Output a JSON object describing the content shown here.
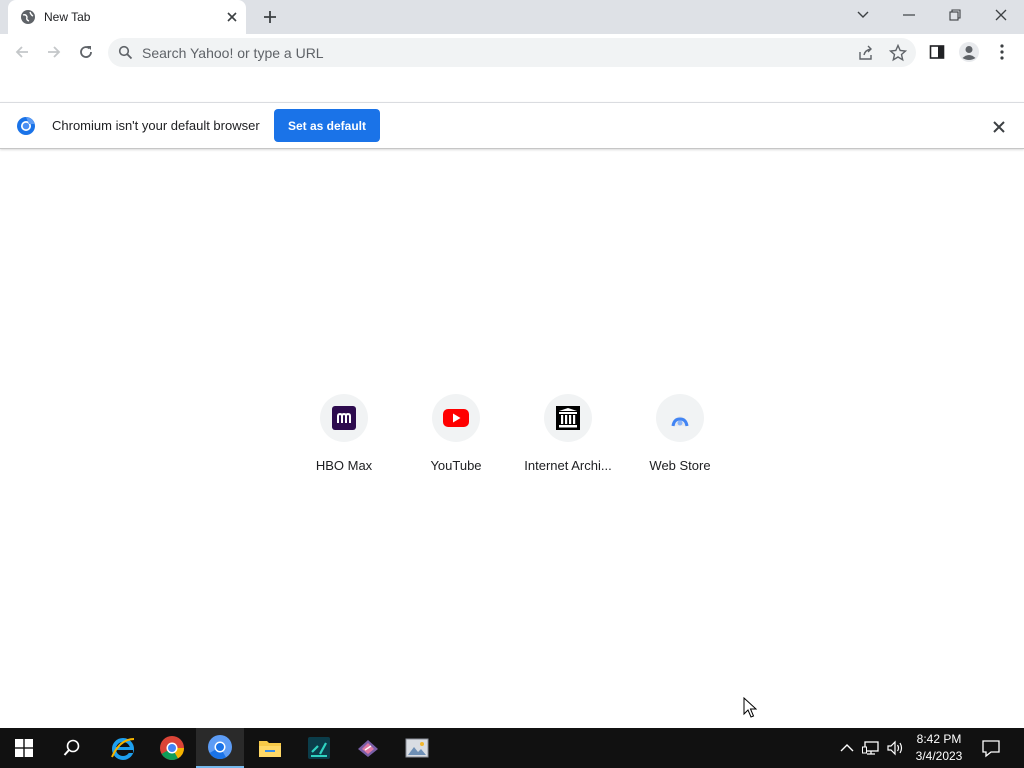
{
  "browser": {
    "tab": {
      "title": "New Tab"
    },
    "omnibox": {
      "placeholder": "Search Yahoo! or type a URL"
    },
    "icons": [
      "globe-icon",
      "close-icon",
      "plus-icon",
      "chevron-down-icon",
      "minimize-icon",
      "restore-icon",
      "close-window-icon",
      "back-arrow-icon",
      "forward-arrow-icon",
      "reload-icon",
      "search-icon",
      "share-icon",
      "star-icon",
      "side-panel-icon",
      "profile-icon",
      "more-vert-icon"
    ]
  },
  "infobar": {
    "message": "Chromium isn't your default browser",
    "button_label": "Set as default"
  },
  "shortcuts": [
    {
      "label": "HBO Max",
      "icon": "hbo-max-icon",
      "color": "#2d0b4e"
    },
    {
      "label": "YouTube",
      "icon": "youtube-icon",
      "color": "#ff0000"
    },
    {
      "label": "Internet Archi...",
      "icon": "internet-archive-icon",
      "color": "#000000"
    },
    {
      "label": "Web Store",
      "icon": "web-store-icon",
      "color": "#4285f4"
    }
  ],
  "taskbar": {
    "apps": [
      "windows-start-icon",
      "search-icon",
      "internet-explorer-icon",
      "chrome-icon",
      "chromium-icon",
      "file-explorer-icon",
      "terminal-app-icon",
      "paint-app-icon",
      "image-viewer-icon"
    ],
    "clock_time": "8:42 PM",
    "clock_date": "3/4/2023"
  },
  "colors": {
    "accent": "#1a73e8",
    "titlebar": "#dee1e6",
    "taskbar": "#111111"
  }
}
